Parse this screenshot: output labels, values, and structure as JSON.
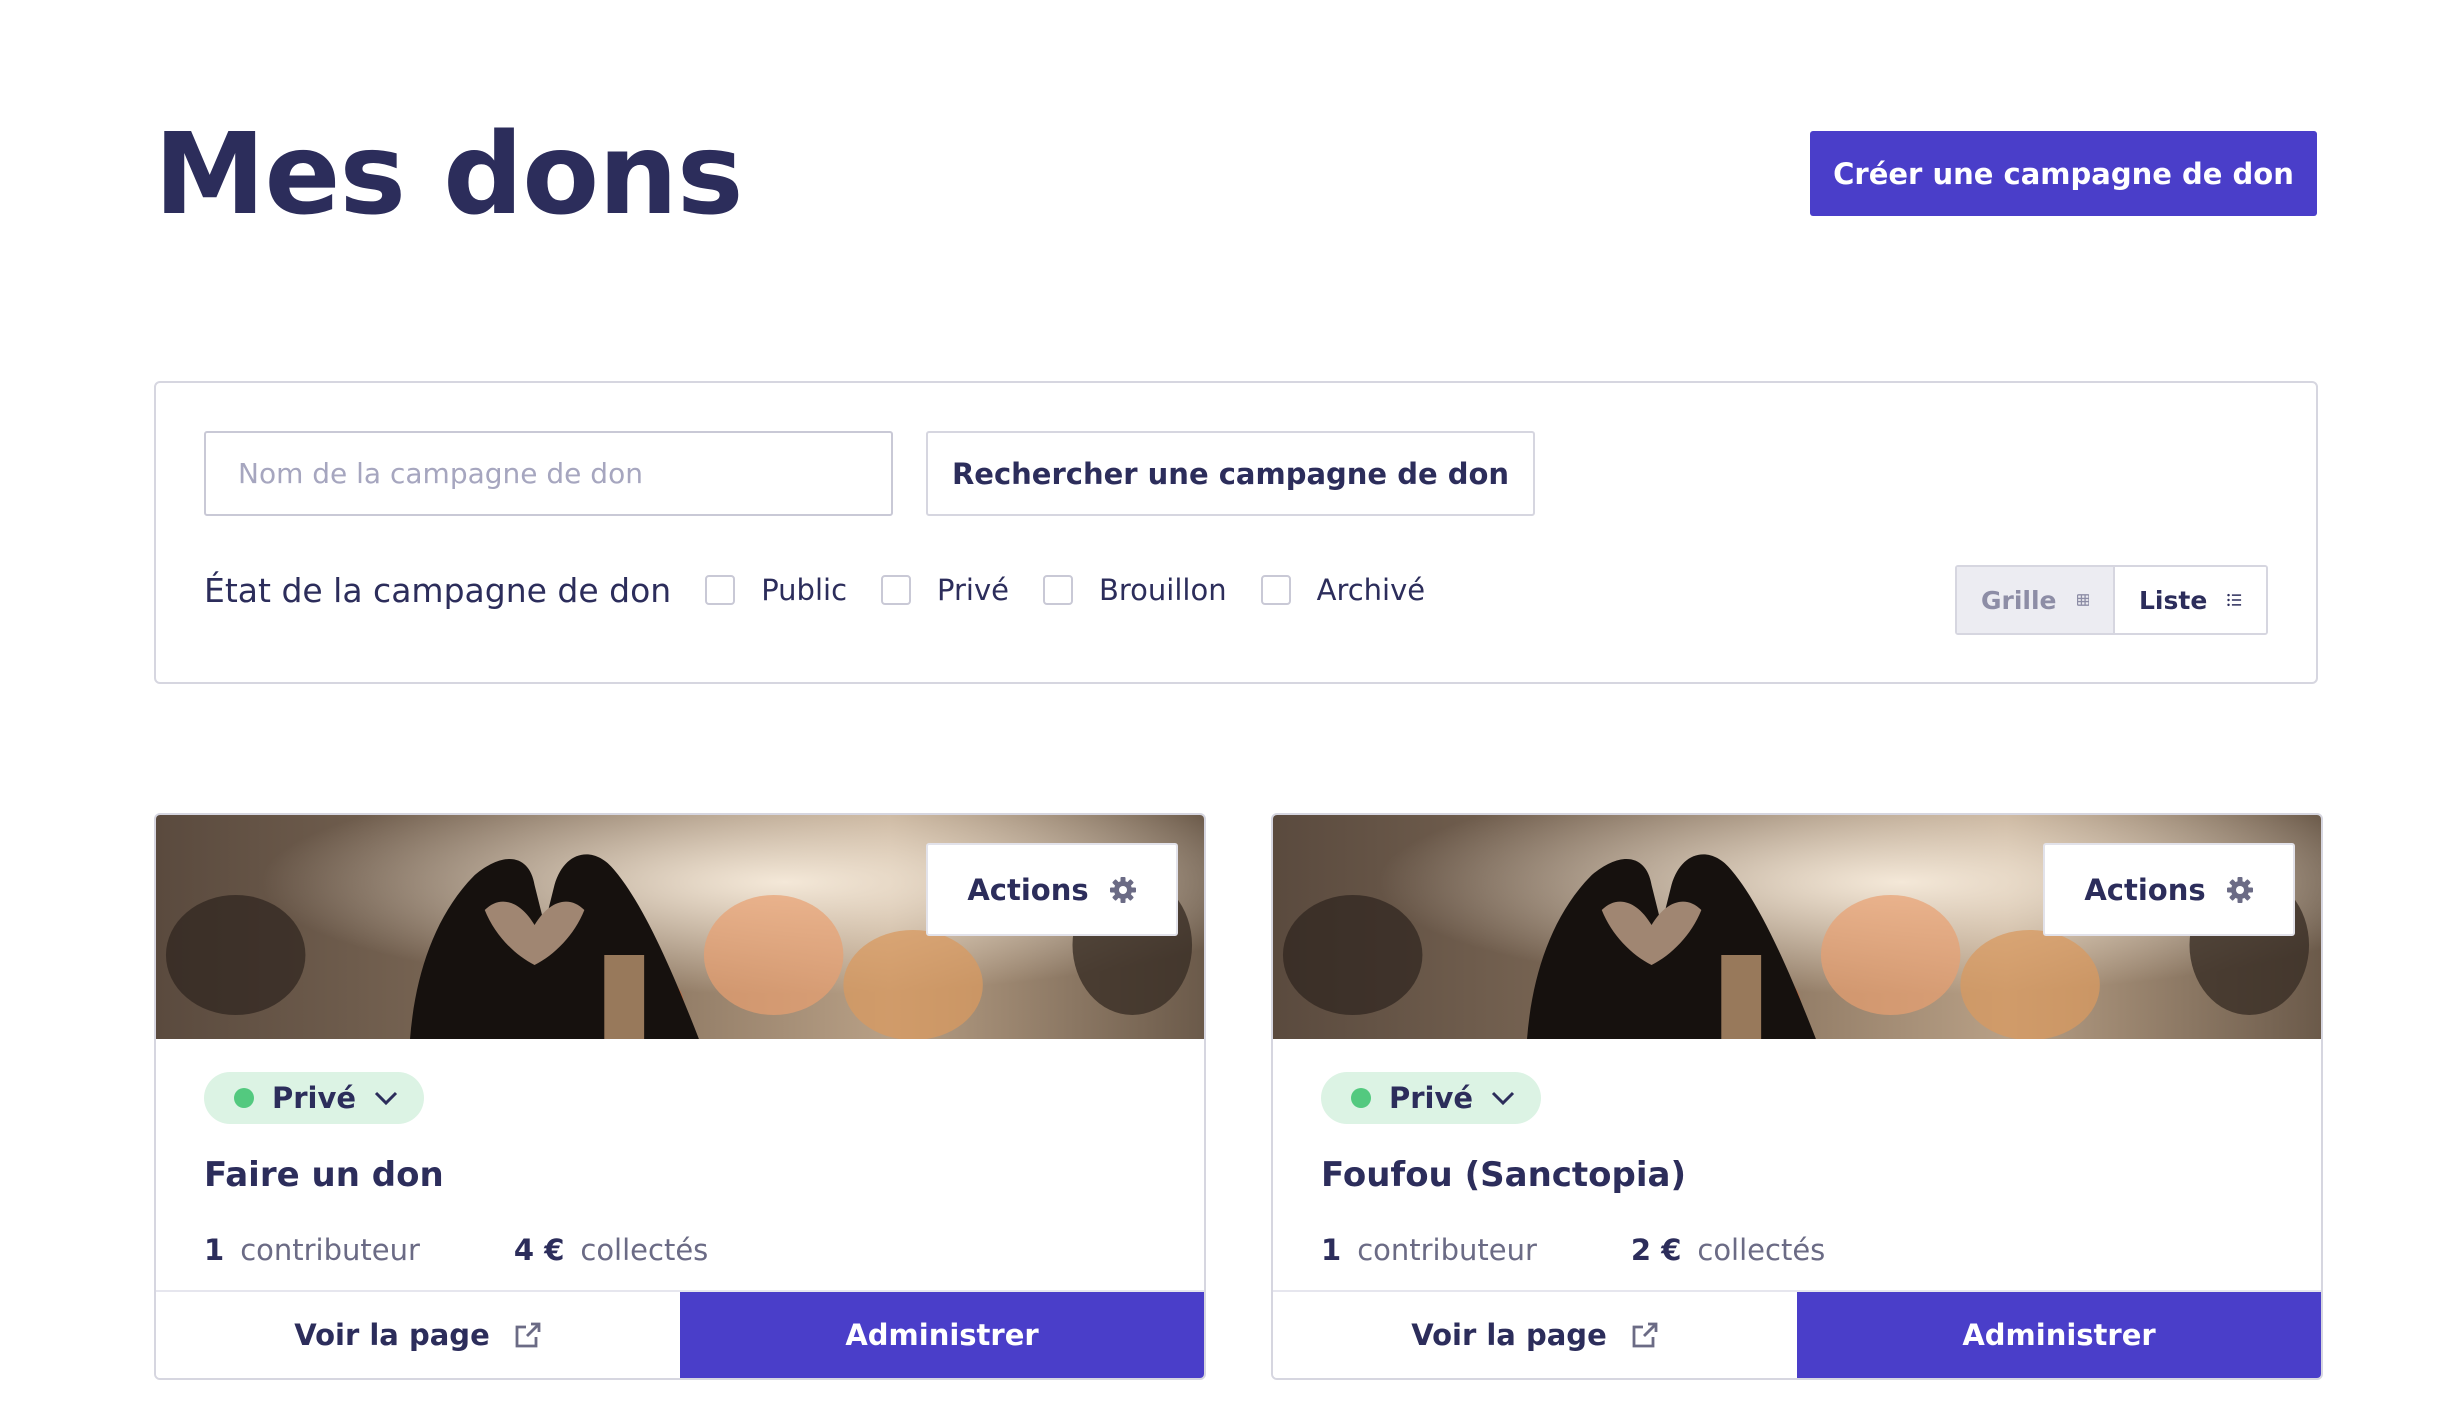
{
  "header": {
    "title": "Mes dons",
    "create_button": "Créer une campagne de don"
  },
  "filters": {
    "search_placeholder": "Nom de la campagne de don",
    "search_value": "",
    "search_button": "Rechercher une campagne de don",
    "state_label": "État de la campagne de don",
    "states": [
      {
        "label": "Public",
        "checked": false
      },
      {
        "label": "Privé",
        "checked": false
      },
      {
        "label": "Brouillon",
        "checked": false
      },
      {
        "label": "Archivé",
        "checked": false
      }
    ],
    "view_grid": "Grille",
    "view_list": "Liste",
    "active_view": "grid"
  },
  "campaigns": [
    {
      "actions_label": "Actions",
      "status": "Privé",
      "title": "Faire un don",
      "contributors_count": "1",
      "contributors_label": "contributeur",
      "amount": "4 €",
      "amount_label": "collectés",
      "view_page": "Voir la page",
      "admin": "Administrer"
    },
    {
      "actions_label": "Actions",
      "status": "Privé",
      "title": "Foufou (Sanctopia)",
      "contributors_count": "1",
      "contributors_label": "contributeur",
      "amount": "2 €",
      "amount_label": "collectés",
      "view_page": "Voir la page",
      "admin": "Administrer"
    }
  ],
  "colors": {
    "accent": "#4a3ec9",
    "text": "#2c2d5b",
    "status_green": "#53c97f",
    "status_bg": "#dcf3e4"
  },
  "icons": {
    "grid_view": "grid-icon",
    "list_view": "list-icon",
    "actions": "gear-icon",
    "status_dropdown": "chevron-down-icon",
    "view_page": "external-link-icon"
  }
}
